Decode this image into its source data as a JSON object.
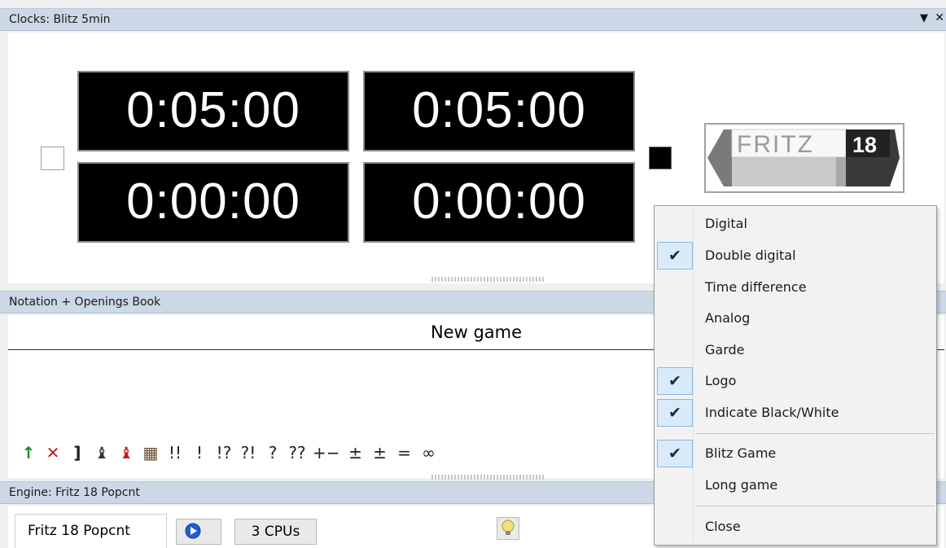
{
  "clock_panel": {
    "title": "Clocks: Blitz 5min",
    "clocks": [
      "0:05:00",
      "0:05:00",
      "0:00:00",
      "0:00:00"
    ],
    "logo_text": "FRITZ",
    "logo_number": "18"
  },
  "notation_panel": {
    "title": "Notation + Openings Book",
    "game_title": "New game",
    "toolbar": [
      "↑",
      "✕",
      "]",
      "♝",
      "♝",
      "▦",
      "!!",
      "!",
      "!?",
      "?!",
      "?",
      "??",
      "+−",
      "±",
      "±",
      "=",
      "∞"
    ]
  },
  "engine_panel": {
    "title": "Engine: Fritz 18 Popcnt",
    "engine_tab": "Fritz 18 Popcnt",
    "cpus": "3 CPUs"
  },
  "context_menu": {
    "items": [
      {
        "label": "Digital",
        "checked": false
      },
      {
        "label": "Double digital",
        "checked": true
      },
      {
        "label": "Time difference",
        "checked": false
      },
      {
        "label": "Analog",
        "checked": false
      },
      {
        "label": "Garde",
        "checked": false
      },
      {
        "label": "Logo",
        "checked": true
      },
      {
        "label": "Indicate Black/White",
        "checked": true
      },
      {
        "label": "Blitz Game",
        "checked": true
      },
      {
        "label": "Long game",
        "checked": false
      },
      {
        "label": "Close",
        "checked": false
      }
    ],
    "check_glyph": "✔"
  },
  "colors": {
    "titlebar": "#ccd8e6",
    "menu_check_bg": "#d9eafb",
    "menu_check_border": "#8cb8e6"
  },
  "icons": {
    "pin": "▼",
    "close": "✕"
  }
}
